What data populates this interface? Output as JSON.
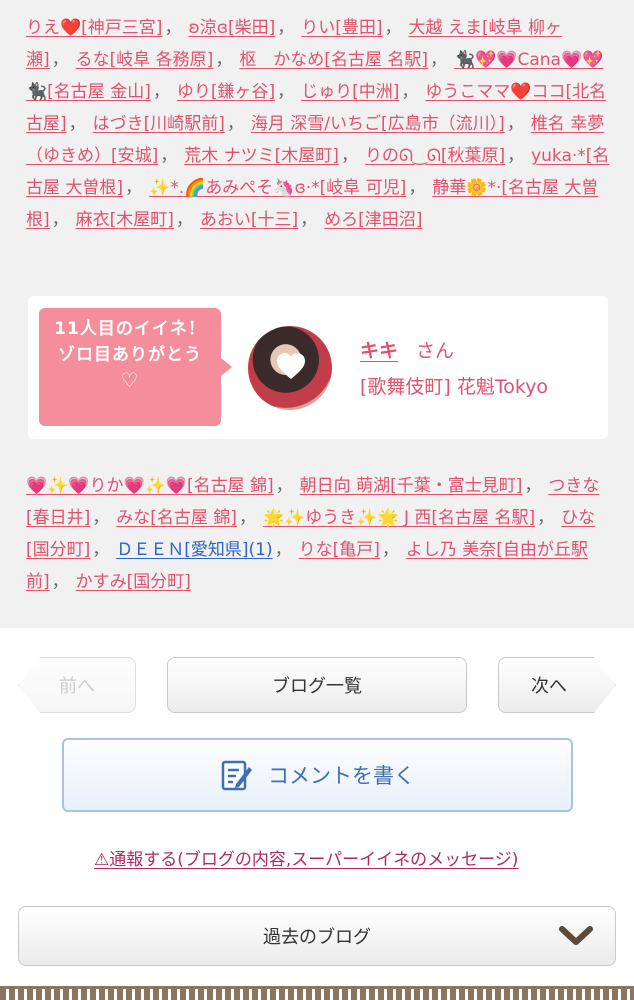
{
  "likes_top": [
    "りえ❤️[神戸三宮]",
    "ʚ涼ɞ[柴田]",
    "りい[豊田]",
    "大越 えま[岐阜 柳ヶ瀬]",
    "るな[岐阜 各務原]",
    "枢　かなめ[名古屋 名駅]",
    "🐈‍⬛💖💗Cana💗💖🐈‍⬛[名古屋 金山]",
    "ゆり[鎌ヶ谷]",
    "じゅり[中洲]",
    "ゆうこママ❤️ココ[北名古屋]",
    "はづき[川崎駅前]",
    "海月 深雪/いちご[広島市（流川）]",
    "椎名 幸夢（ゆきめ）[安城]",
    "荒木 ナツミ[木屋町]",
    "りのᘏ‿ᘏ[秋葉原]",
    "yuka·*[名古屋 大曽根]",
    "✨*.🌈あみぺそ🦄ɞ·*[岐阜 可児]",
    "静華🌼*·[名古屋 大曽根]",
    "麻衣[木屋町]",
    "あおい[十三]",
    "めろ[津田沼]"
  ],
  "card": {
    "ribbon_line1": "11人目のイイネ！",
    "ribbon_line2": "ゾロ目ありがとう",
    "ribbon_heart": "♡",
    "name": "キキ",
    "san": "さん",
    "shop": "[歌舞伎町] 花魁Tokyo"
  },
  "likes_bottom": [
    {
      "text": "💗✨💗りか💗✨💗[名古屋 錦]",
      "blue": false
    },
    {
      "text": "朝日向 萌湖[千葉・富士見町]",
      "blue": false
    },
    {
      "text": "つきな[春日井]",
      "blue": false
    },
    {
      "text": "みな[名古屋 錦]",
      "blue": false
    },
    {
      "text": "🌟✨ゆうき✨🌟 J 西[名古屋 名駅]",
      "blue": false
    },
    {
      "text": "ひな[国分町]",
      "blue": false
    },
    {
      "text": "ＤＥＥＮ[愛知県](1)",
      "blue": true
    },
    {
      "text": "りな[亀戸]",
      "blue": false
    },
    {
      "text": "よし乃 美奈[自由が丘駅前]",
      "blue": false
    },
    {
      "text": "かすみ[国分町]",
      "blue": false
    }
  ],
  "nav": {
    "prev": "前へ",
    "list": "ブログ一覧",
    "next": "次へ",
    "comment": "コメントを書く",
    "report": "⚠通報する(ブログの内容,スーパーイイネのメッセージ)",
    "past": "過去のブログ"
  },
  "icons": {
    "comment": "pencil-note-icon",
    "past": "chevron-down-icon",
    "avatar_mask": "heart-icon"
  },
  "colors": {
    "link_pink": "#e0526e",
    "link_blue": "#2e63c9",
    "ribbon": "#f48d9c",
    "report": "#b02a63"
  }
}
